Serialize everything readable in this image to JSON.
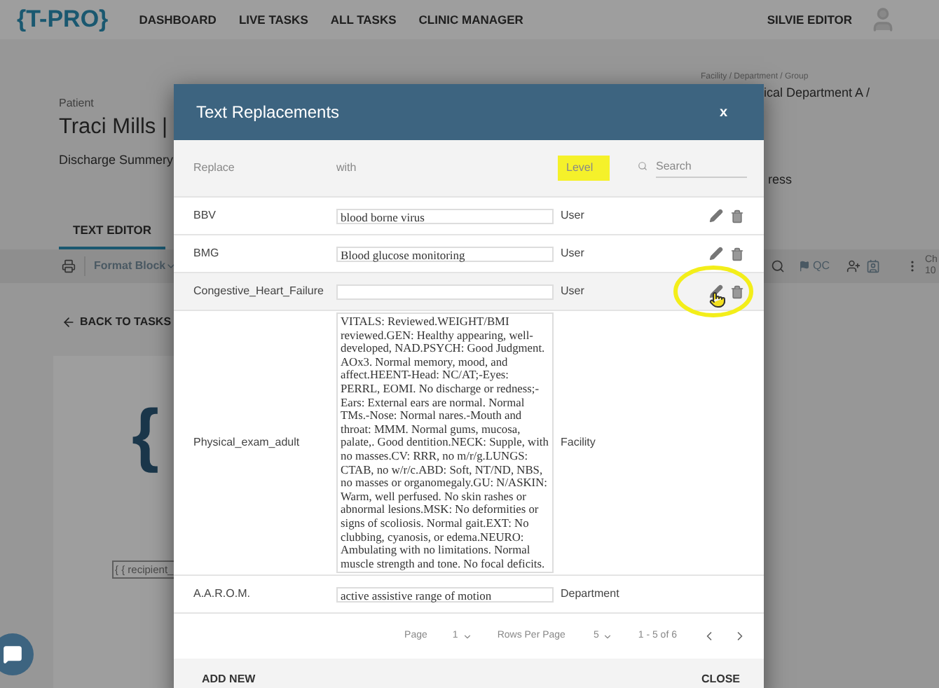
{
  "nav": {
    "logo": "{T-PRO}",
    "items": [
      "DASHBOARD",
      "LIVE TASKS",
      "ALL TASKS",
      "CLINIC MANAGER"
    ],
    "user": "SILVIE EDITOR"
  },
  "patient": {
    "label": "Patient",
    "name": "Traci Mills |",
    "document": "Discharge Summery"
  },
  "facility": {
    "label": "Facility / Department / Group",
    "value": "ical Department A /",
    "status": "ress"
  },
  "tabs": [
    {
      "label": "TEXT EDITOR",
      "selected": true
    }
  ],
  "toolbar": {
    "format": "Format Block",
    "qc": "QC",
    "cut_label": "Ch",
    "cut_value": "10"
  },
  "back_link": "BACK TO TASKS",
  "document": {
    "logo": "{",
    "field": "{ { recipient_"
  },
  "dialog": {
    "title": "Text Replacements",
    "close": "x",
    "columns": [
      {
        "label": "Replace",
        "highlighted": false
      },
      {
        "label": "with",
        "highlighted": false
      },
      {
        "label": "Level",
        "highlighted": true
      }
    ],
    "search": {
      "placeholder": "Search"
    },
    "rows": [
      {
        "replace": "BBV",
        "with": "blood borne virus",
        "level": "User",
        "hovered": false,
        "annotated": false
      },
      {
        "replace": "BMG",
        "with": "Blood glucose monitoring",
        "level": "User",
        "hovered": false,
        "annotated": false
      },
      {
        "replace": "Congestive_Heart_Failure",
        "level": "User",
        "hovered": true,
        "annotated": true
      },
      {
        "replace": "Physical_exam_adult",
        "with": " VITALS: Reviewed.WEIGHT/BMI reviewed.GEN: Healthy appearing, well-developed, NAD.PSYCH: Good Judgment. AOx3. Normal memory, mood, and affect.HEENT-Head: NC/AT;-Eyes: PERRL, EOMI. No discharge or redness;-Ears: External ears are normal. Normal TMs.-Nose: Normal nares.-Mouth and throat: MMM. Normal gums, mucosa, palate,. Good dentition.NECK: Supple, with no masses.CV: RRR, no m/r/g.LUNGS: CTAB, no w/r/c.ABD: Soft, NT/ND, NBS, no masses or organomegaly.GU: N/ASKIN: Warm, well perfused. No skin rashes or abnormal lesions.MSK: No deformities or signs of scoliosis. Normal gait.EXT: No clubbing, cyanosis, or edema.NEURO: Ambulating with no limitations. Normal muscle strength and tone. No focal deficits.",
        "level": "Facility",
        "hovered": false,
        "annotated": false
      },
      {
        "replace": "A.A.R.O.M.",
        "with": "active assistive range of motion",
        "level": "Department",
        "hovered": false,
        "annotated": false
      }
    ],
    "pagination": {
      "page_label": "Page",
      "page": "1",
      "rows_label": "Rows Per Page",
      "rows": "5",
      "range": "1 - 5 of 6"
    },
    "buttons": [
      "ADD NEW",
      "CLOSE"
    ]
  }
}
